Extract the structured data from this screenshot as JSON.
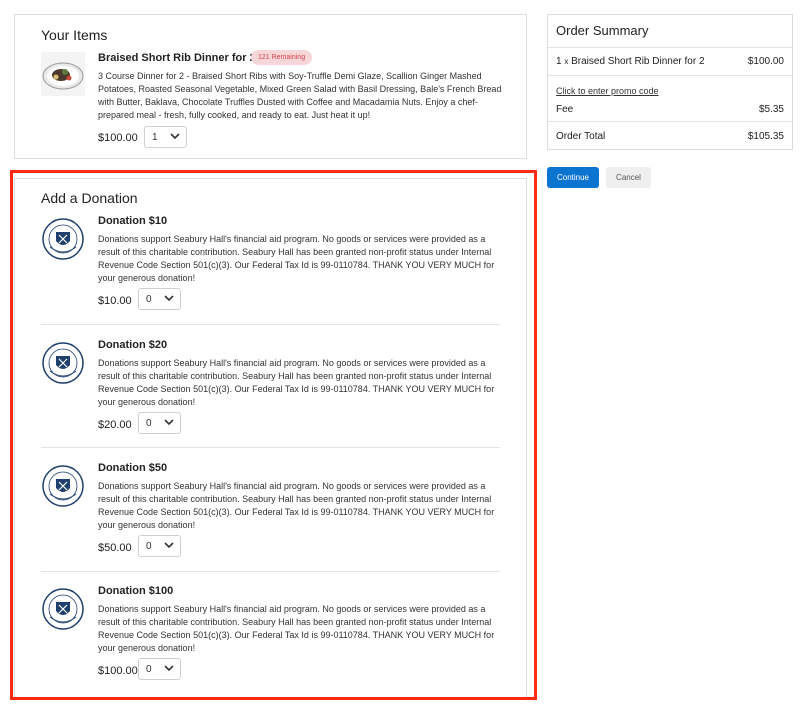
{
  "items": {
    "title": "Your Items",
    "item": {
      "name": "Braised Short Rib Dinner for 2",
      "badge": "121 Remaining",
      "description": "3 Course Dinner for 2 - Braised Short Ribs with Soy-Truffle Demi Glaze, Scallion Ginger Mashed Potatoes, Roasted Seasonal Vegetable, Mixed Green Salad with Basil Dressing, Bale's French Bread with Butter, Baklava, Chocolate Truffles Dusted with Coffee and Macadamia Nuts. Enjoy a chef-prepared meal - fresh, fully cooked, and ready to eat. Just heat it up!",
      "price": "$100.00",
      "qty": "1"
    }
  },
  "summary": {
    "title": "Order Summary",
    "line_qty": "1",
    "line_x": "x",
    "line_name": "Braised Short Rib Dinner for 2",
    "line_price": "$100.00",
    "promo": "Click to enter promo code",
    "fee_label": "Fee",
    "fee_value": "$5.35",
    "total_label": "Order Total",
    "total_value": "$105.35"
  },
  "buttons": {
    "continue": "Continue",
    "cancel": "Cancel"
  },
  "donation": {
    "title": "Add a Donation",
    "rows": [
      {
        "name": "Donation $10",
        "description": "Donations support Seabury Hall's financial aid program. No goods or services were provided as a result of this charitable contribution. Seabury Hall has been granted non-profit status under Internal Revenue Code Section 501(c)(3). Our Federal Tax Id is 99-0110784. THANK YOU VERY MUCH for your generous donation!",
        "price": "$10.00",
        "qty": "0"
      },
      {
        "name": "Donation $20",
        "description": "Donations support Seabury Hall's financial aid program. No goods or services were provided as a result of this charitable contribution. Seabury Hall has been granted non-profit status under Internal Revenue Code Section 501(c)(3). Our Federal Tax Id is 99-0110784.  THANK YOU VERY MUCH for your generous donation!",
        "price": "$20.00",
        "qty": "0"
      },
      {
        "name": "Donation $50",
        "description": "Donations support Seabury Hall's financial aid program. No goods or services were provided as a result of this charitable contribution. Seabury Hall has been granted non-profit status under Internal Revenue Code Section 501(c)(3). Our Federal Tax Id is 99-0110784. THANK YOU VERY MUCH for your generous donation!",
        "price": "$50.00",
        "qty": "0"
      },
      {
        "name": "Donation $100",
        "description": "Donations support Seabury Hall's financial aid program. No goods or services were provided as a result of this charitable contribution. Seabury Hall has been granted non-profit status under Internal Revenue Code Section 501(c)(3). Our Federal Tax Id is 99-0110784. THANK YOU VERY MUCH for your generous donation!",
        "price": "$100.00",
        "qty": "0"
      }
    ]
  },
  "colors": {
    "accent": "#0b73d0",
    "badge_bg": "#f6d6d8",
    "badge_text": "#d9434e",
    "highlight": "#ff2a10",
    "seal": "#1f3f6e"
  },
  "icons": {
    "item_image": "food-photo",
    "donation_image": "seabury-hall-seal",
    "select": "chevron-down-icon"
  }
}
